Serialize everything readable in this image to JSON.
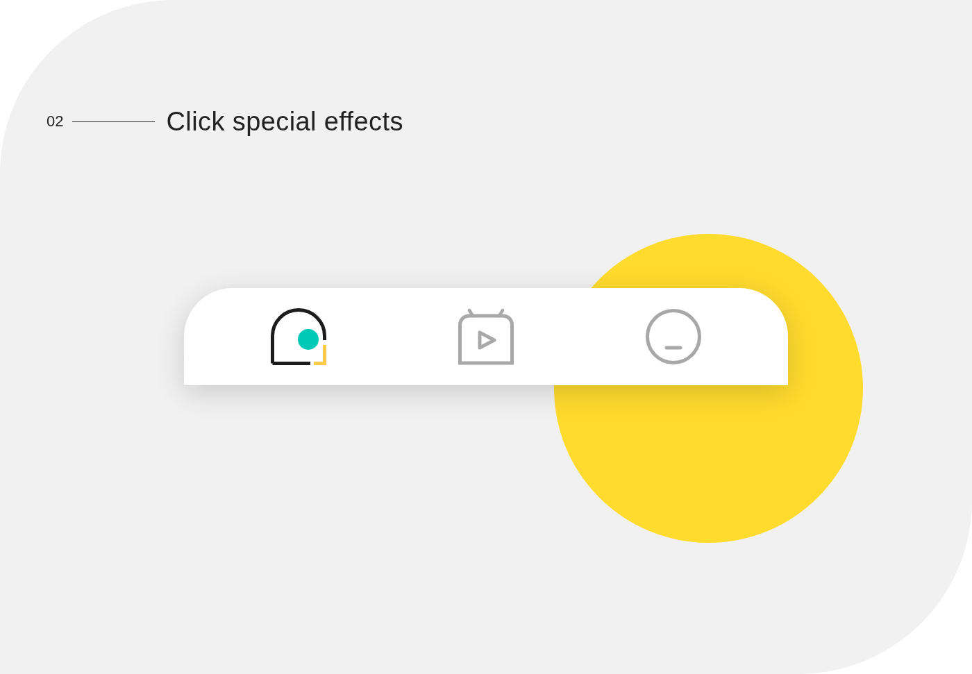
{
  "section": {
    "number": "02",
    "title": "Click special effects"
  },
  "tab_bar": {
    "tabs": [
      {
        "kind": "dome",
        "selected": true
      },
      {
        "kind": "tv",
        "selected": false
      },
      {
        "kind": "circle",
        "selected": false
      }
    ]
  }
}
